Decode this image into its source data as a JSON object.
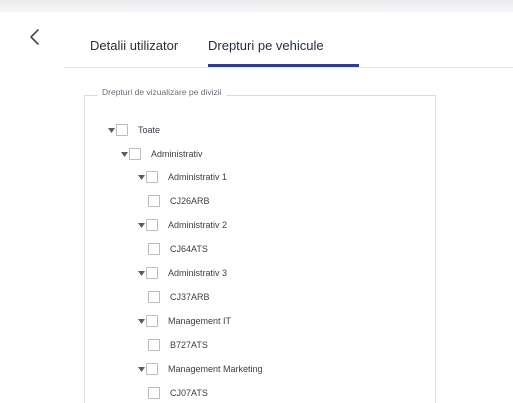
{
  "tabs": [
    {
      "label": "Detalii utilizator",
      "active": false
    },
    {
      "label": "Drepturi pe vehicule",
      "active": true
    }
  ],
  "section": {
    "legend": "Drepturi de vizualizare pe divizii"
  },
  "tree": [
    {
      "label": "Toate",
      "expanded": true,
      "checked": false
    },
    {
      "label": "Administrativ",
      "expanded": true,
      "checked": false
    },
    {
      "label": "Administrativ 1",
      "expanded": true,
      "checked": false
    },
    {
      "label": "CJ26ARB",
      "checked": false
    },
    {
      "label": "Administrativ 2",
      "expanded": true,
      "checked": false
    },
    {
      "label": "CJ64ATS",
      "checked": false
    },
    {
      "label": "Administrativ 3",
      "expanded": true,
      "checked": false
    },
    {
      "label": "CJ37ARB",
      "checked": false
    },
    {
      "label": "Management IT",
      "expanded": true,
      "checked": false
    },
    {
      "label": "B727ATS",
      "checked": false
    },
    {
      "label": "Management Marketing",
      "expanded": true,
      "checked": false
    },
    {
      "label": "CJ07ATS",
      "checked": false
    }
  ],
  "colors": {
    "accent": "#2d3e8f",
    "border": "#d9dbdf"
  },
  "icons": {
    "back": "chevron-left-icon",
    "expand": "caret-down-icon"
  }
}
